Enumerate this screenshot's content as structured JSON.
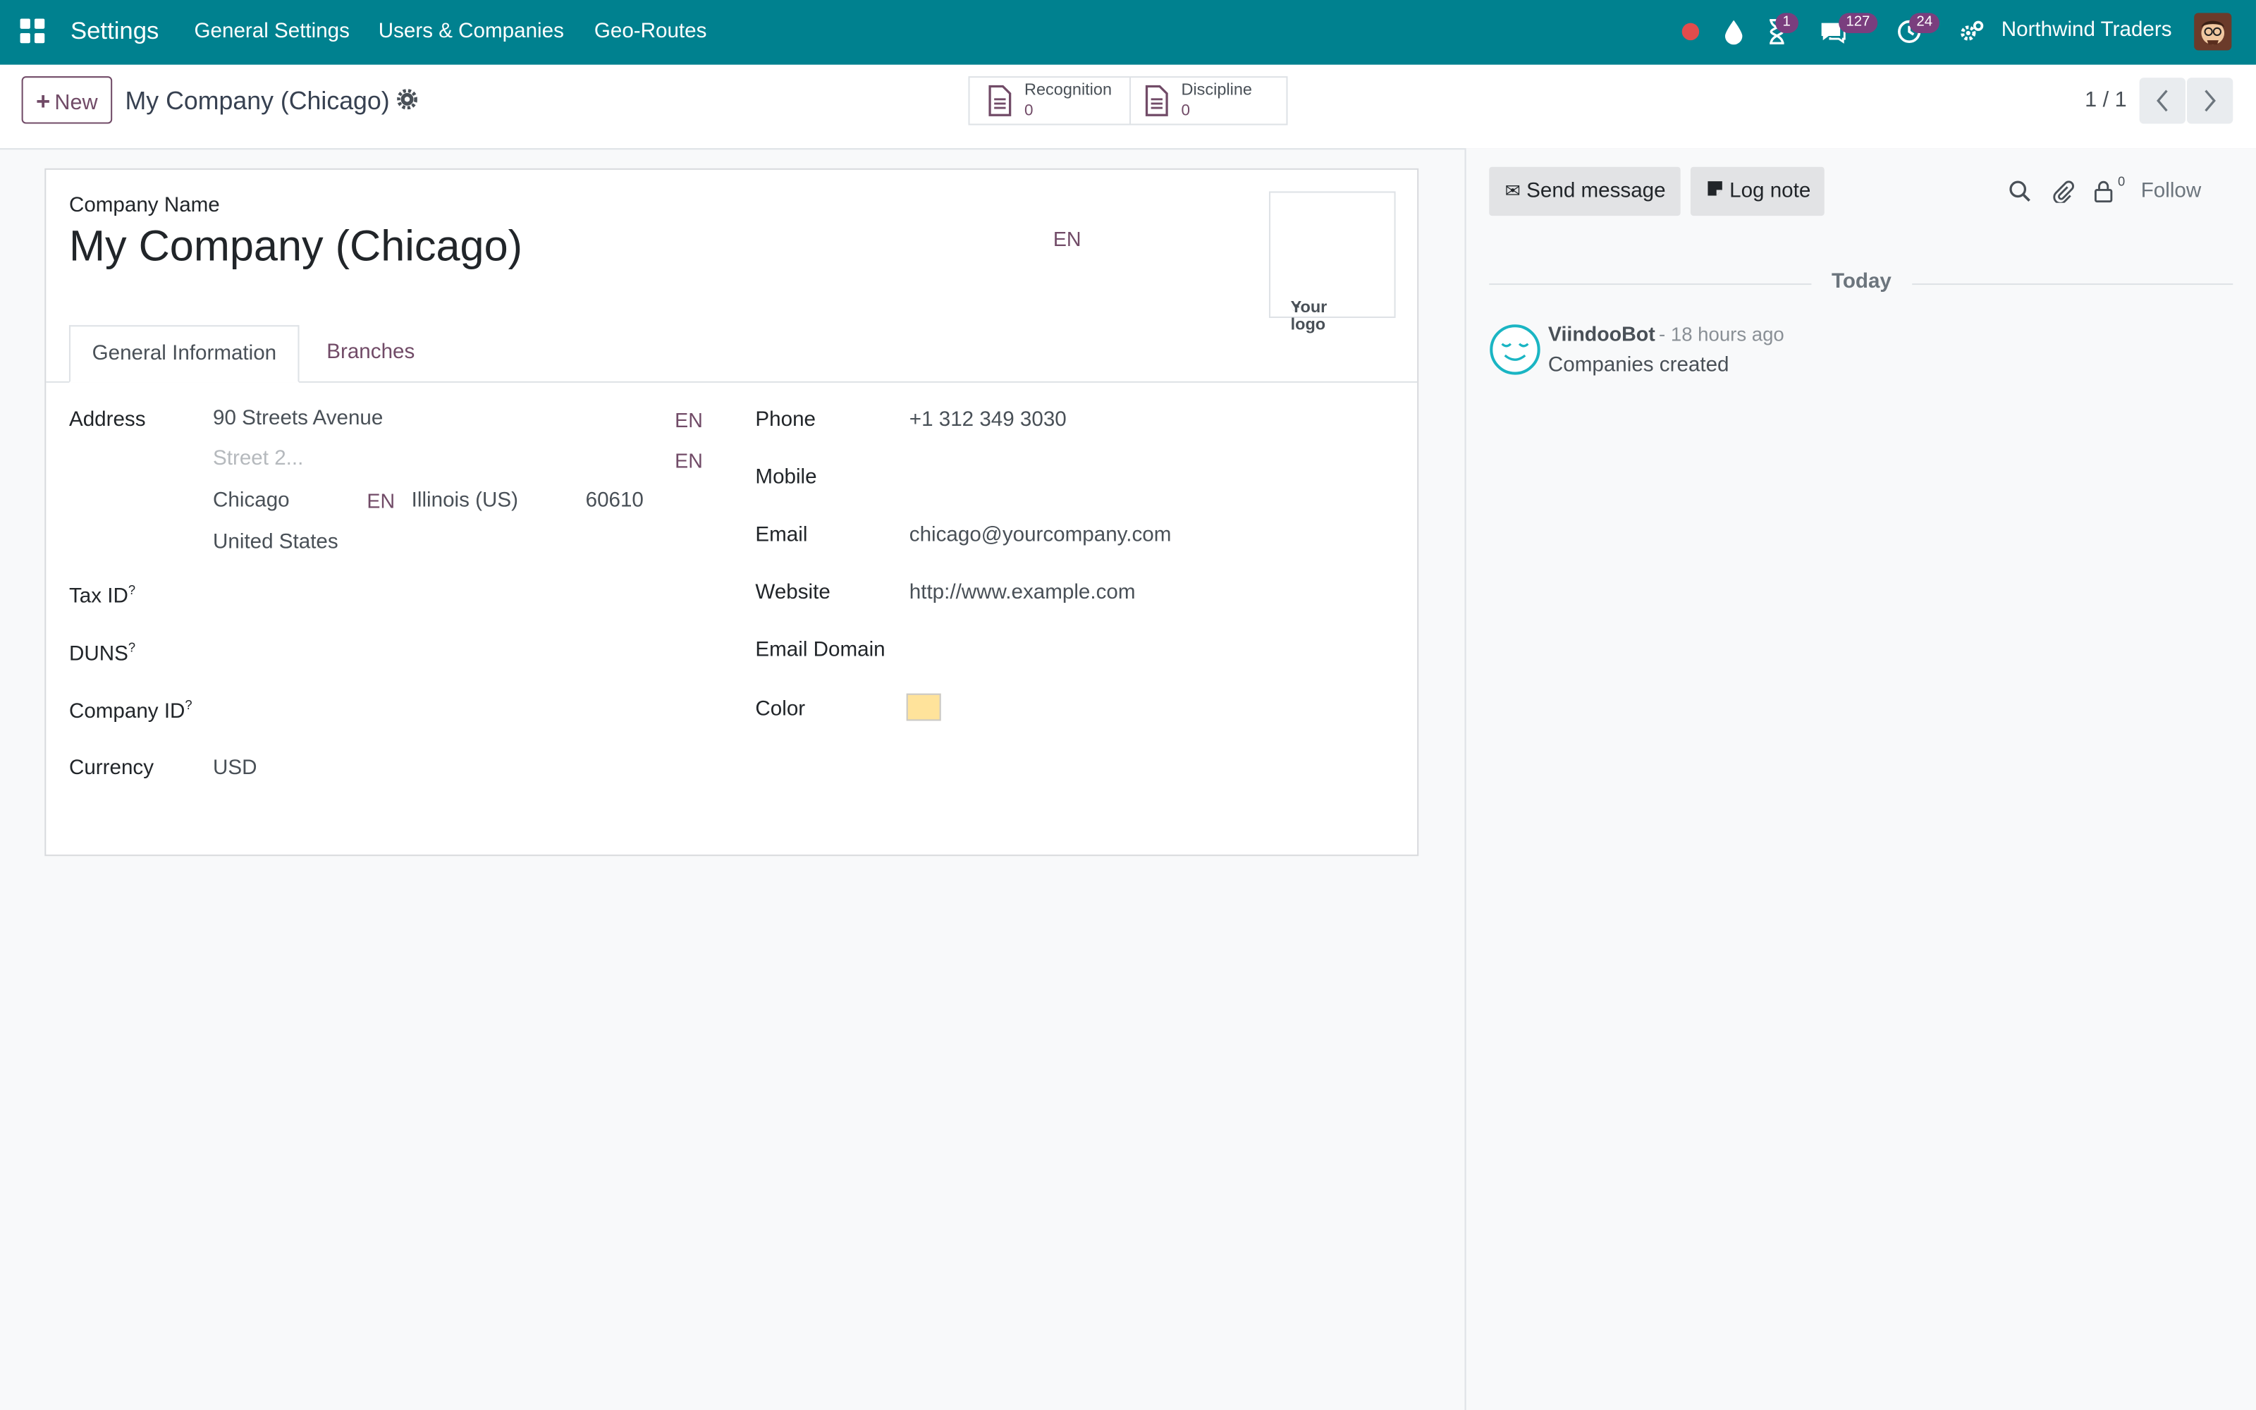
{
  "navbar": {
    "app_title": "Settings",
    "menu": [
      "General Settings",
      "Users & Companies",
      "Geo-Routes"
    ],
    "badges": {
      "activity": "1",
      "messages": "127",
      "reminders": "24"
    },
    "company": "Northwind Traders",
    "color": "#00818f"
  },
  "control_panel": {
    "new_label": "New",
    "breadcrumb_title": "My Company (Chicago)",
    "smart_buttons": [
      {
        "label": "Recognition",
        "value": "0",
        "icon": "document-icon"
      },
      {
        "label": "Discipline",
        "value": "0",
        "icon": "document-icon"
      }
    ],
    "pager": "1 / 1"
  },
  "form": {
    "company_name_label": "Company Name",
    "company_name": "My Company (Chicago)",
    "lang_tag": "EN",
    "logo_placeholder": "Your logo",
    "tabs": [
      "General Information",
      "Branches"
    ],
    "left": {
      "address_label": "Address",
      "street": "90 Streets Avenue",
      "street2_placeholder": "Street 2...",
      "city": "Chicago",
      "state": "Illinois (US)",
      "zip": "60610",
      "country": "United States",
      "tax_id_label": "Tax ID",
      "duns_label": "DUNS",
      "company_id_label": "Company ID",
      "help_mark": "?",
      "currency_label": "Currency",
      "currency": "USD"
    },
    "right": {
      "phone_label": "Phone",
      "phone": "+1 312 349 3030",
      "mobile_label": "Mobile",
      "email_label": "Email",
      "email": "chicago@yourcompany.com",
      "website_label": "Website",
      "website": "http://www.example.com",
      "email_domain_label": "Email Domain",
      "color_label": "Color",
      "color_value": "#ffe39b"
    }
  },
  "chatter": {
    "send_message": "Send message",
    "log_note": "Log note",
    "follower_count": "0",
    "follow": "Follow",
    "today": "Today",
    "message": {
      "author": "ViindooBot",
      "time": "- 18 hours ago",
      "body": "Companies created"
    }
  },
  "accent": "#714b67"
}
